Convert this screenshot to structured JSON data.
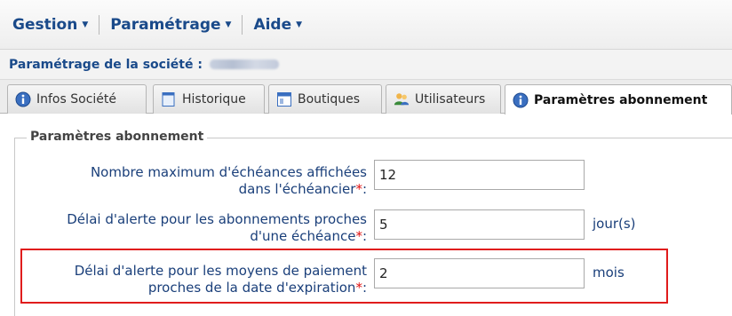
{
  "menu": {
    "items": [
      {
        "label": "Gestion"
      },
      {
        "label": "Paramétrage"
      },
      {
        "label": "Aide"
      }
    ]
  },
  "company": {
    "title": "Paramétrage de la société :"
  },
  "tabs": [
    {
      "label": "Infos Société",
      "icon": "info-icon",
      "active": false
    },
    {
      "label": "Historique",
      "icon": "history-icon",
      "active": false
    },
    {
      "label": "Boutiques",
      "icon": "shop-icon",
      "active": false
    },
    {
      "label": "Utilisateurs",
      "icon": "users-icon",
      "active": false
    },
    {
      "label": "Paramètres abonnement",
      "icon": "info-icon",
      "active": true
    }
  ],
  "section": {
    "legend": "Paramètres abonnement",
    "fields": [
      {
        "label_line1": "Nombre maximum d'échéances affichées",
        "label_line2": "dans l'échéancier",
        "required": "*",
        "colon": ":",
        "value": "12",
        "unit": ""
      },
      {
        "label_line1": "Délai d'alerte pour les abonnements proches",
        "label_line2": "d'une échéance",
        "required": "*",
        "colon": ":",
        "value": "5",
        "unit": "jour(s)"
      },
      {
        "label_line1": "Délai d'alerte pour les moyens de paiement",
        "label_line2": "proches de la date d'expiration",
        "required": "*",
        "colon": ":",
        "value": "2",
        "unit": "mois"
      }
    ]
  },
  "colors": {
    "link_blue": "#1a4a8a",
    "required_red": "#e01010",
    "highlight_red": "#e01c1c"
  }
}
